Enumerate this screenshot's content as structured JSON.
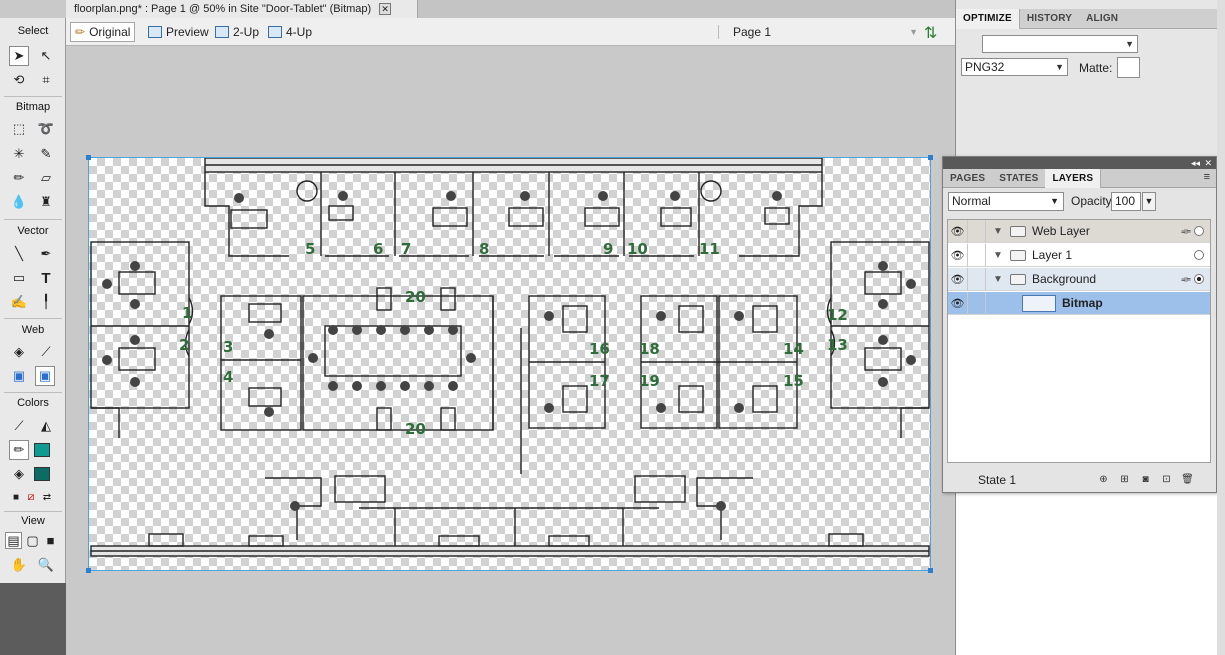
{
  "document": {
    "tab_title": "floorplan.png* : Page 1 @  50% in Site \"Door-Tablet\" (Bitmap)",
    "close_label": "✕"
  },
  "viewbar": {
    "original": "Original",
    "preview": "Preview",
    "two_up": "2-Up",
    "four_up": "4-Up",
    "page": "Page 1"
  },
  "tools": {
    "select": "Select",
    "bitmap": "Bitmap",
    "vector": "Vector",
    "web": "Web",
    "colors": "Colors",
    "view": "View",
    "stroke_color": "#0f9a94",
    "fill_color": "#0d6b66"
  },
  "optimize": {
    "tabs": [
      "OPTIMIZE",
      "HISTORY",
      "ALIGN"
    ],
    "settings_value": "",
    "format": "PNG32",
    "matte_label": "Matte:"
  },
  "layers_panel": {
    "tabs": [
      "PAGES",
      "STATES",
      "LAYERS"
    ],
    "blend_mode": "Normal",
    "opacity_label": "Opacity",
    "opacity_value": "100",
    "layers": [
      {
        "name": "Web Layer"
      },
      {
        "name": "Layer 1"
      },
      {
        "name": "Background"
      },
      {
        "name": "Bitmap"
      }
    ],
    "state_label": "State 1"
  },
  "floorplan": {
    "room_numbers": [
      "1",
      "2",
      "3",
      "4",
      "5",
      "6",
      "7",
      "8",
      "9",
      "10",
      "11",
      "12",
      "13",
      "14",
      "15",
      "16",
      "17",
      "18",
      "19",
      "20",
      "20"
    ]
  }
}
